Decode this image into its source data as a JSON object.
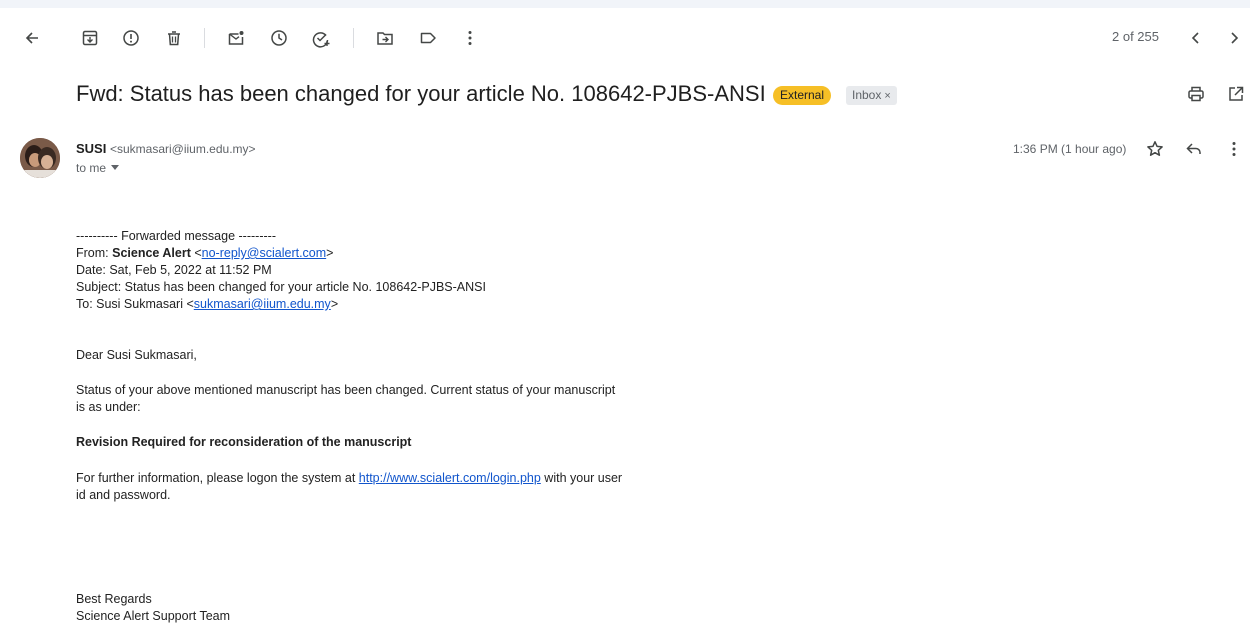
{
  "toolbar": {
    "count": "2 of 255",
    "icons": [
      "back-arrow-icon",
      "archive-icon",
      "report-spam-icon",
      "delete-icon",
      "mark-unread-icon",
      "snooze-icon",
      "add-task-icon",
      "move-to-icon",
      "label-icon",
      "more-vert-icon",
      "newer-icon",
      "older-icon"
    ]
  },
  "subject": {
    "title": "Fwd: Status has been changed for your article No. 108642-PJBS-ANSI",
    "label_external": "External",
    "label_inbox": "Inbox",
    "label_inbox_close": "×"
  },
  "sender": {
    "name": "SUSI",
    "email": "<sukmasari@iium.edu.my>",
    "to": "to me",
    "time": "1:36 PM (1 hour ago)"
  },
  "message": {
    "fwd_header": "---------- Forwarded message ---------",
    "from_label": "From: ",
    "from_name": "Science Alert",
    "from_email": "no-reply@scialert.com",
    "date": "Date: Sat, Feb 5, 2022 at 11:52 PM",
    "subject_line": "Subject: Status has been changed for your article No. 108642-PJBS-ANSI",
    "to_label": "To: Susi Sukmasari ",
    "to_email": "sukmasari@iium.edu.my",
    "greeting": "Dear Susi Sukmasari,",
    "status_line1": "Status of your above mentioned manuscript has been changed. Current status of your manuscript",
    "status_line2": "is as under:",
    "status_bold": "Revision Required for reconsideration of the manuscript",
    "info_line1_pre": "For further information, please logon the system at ",
    "info_link": "http://www.scialert.com/login.php",
    "info_line1_post": " with your user",
    "info_line2": "id and password.",
    "regards": "Best Regards",
    "team": "Science Alert Support Team"
  },
  "colors": {
    "external_label": "#f6bf26",
    "link": "#1155cc",
    "icon": "#444746"
  }
}
